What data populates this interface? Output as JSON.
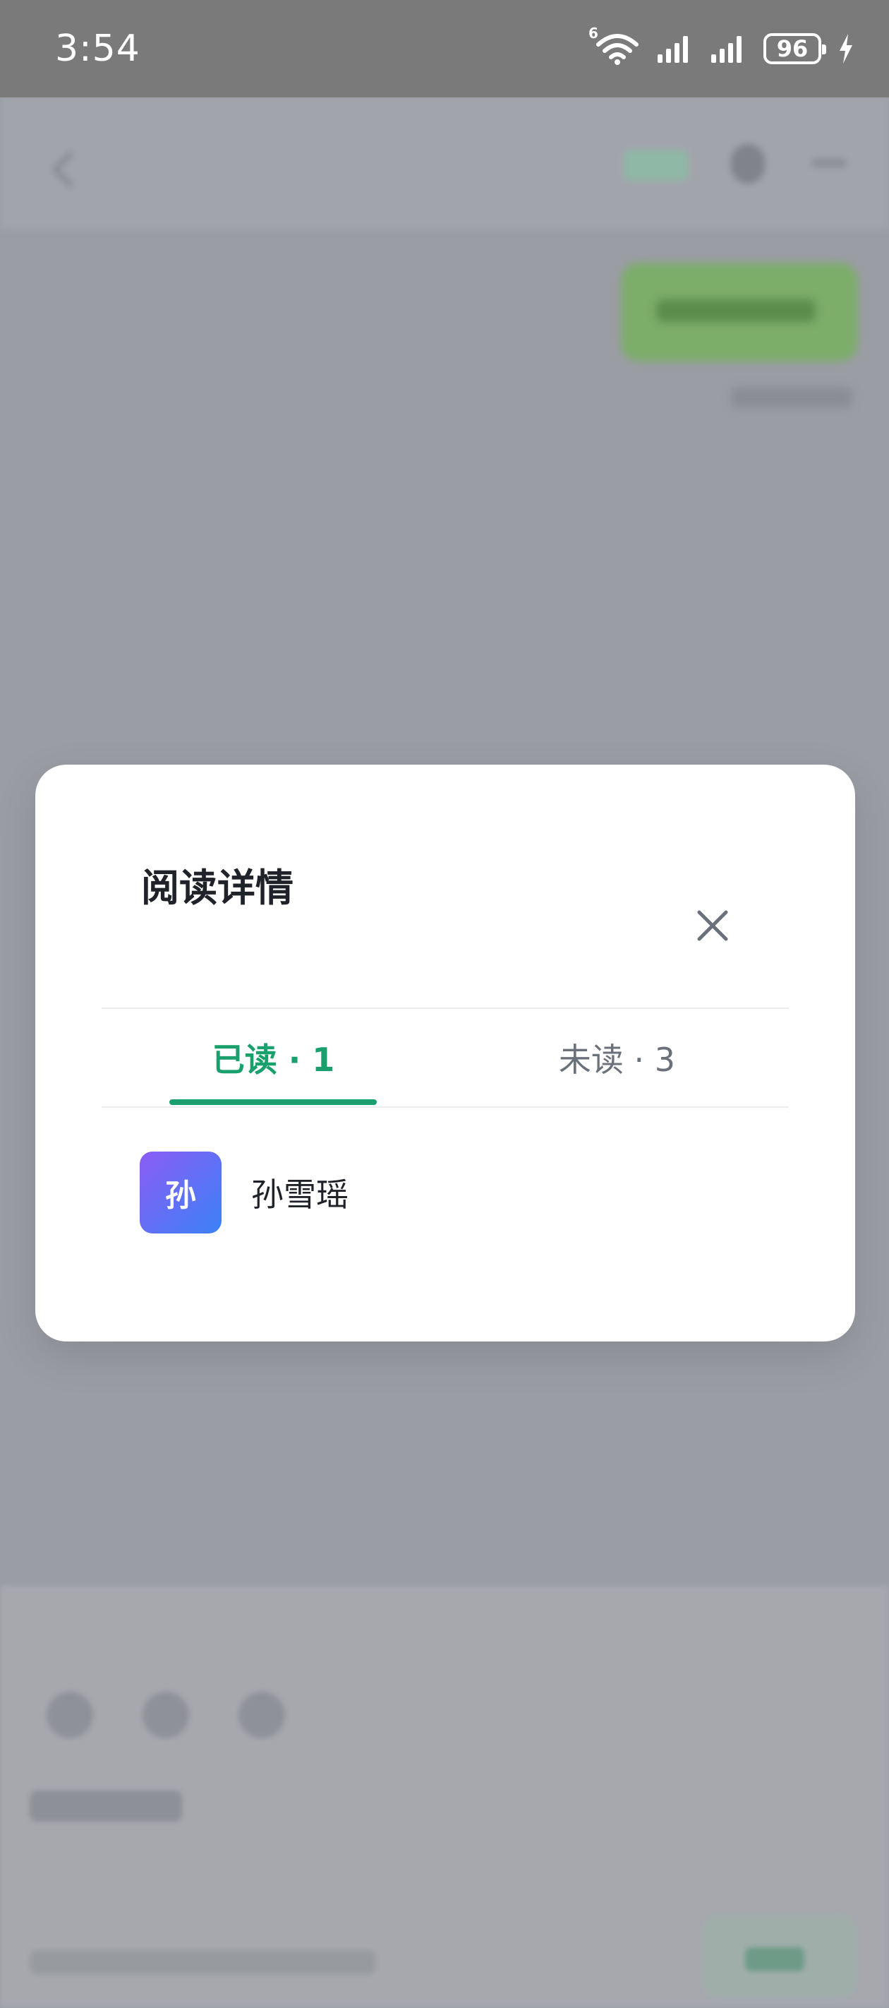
{
  "status_bar": {
    "time": "3:54",
    "battery_level": "96",
    "network_badge": "6",
    "icons": [
      "wifi-icon",
      "signal-icon",
      "signal-icon",
      "battery-icon",
      "charging-icon"
    ]
  },
  "modal": {
    "title": "阅读详情",
    "close_icon": "close-icon",
    "tabs": [
      {
        "label": "已读 · 1",
        "active": true
      },
      {
        "label": "未读 · 3",
        "active": false
      }
    ],
    "readers": [
      {
        "avatar_text": "孙",
        "name": "孙雪瑶"
      }
    ]
  },
  "colors": {
    "accent": "#1aa06d",
    "status_bar": "#7a7a7a",
    "overlay": "#9b9da5",
    "avatar_gradient_start": "#8b5cf6",
    "avatar_gradient_end": "#3b82f6"
  }
}
